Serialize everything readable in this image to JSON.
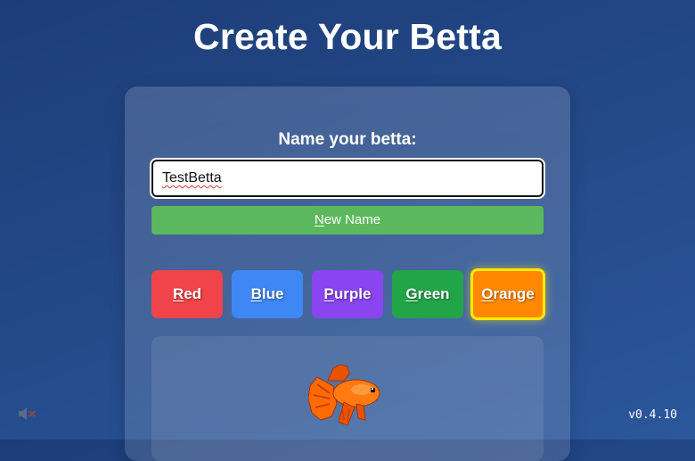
{
  "page": {
    "title": "Create Your Betta"
  },
  "name_form": {
    "label": "Name your betta:",
    "input_value": "TestBetta",
    "new_name_button": {
      "hotkey": "N",
      "rest": "ew Name"
    }
  },
  "colors": [
    {
      "id": "red",
      "hotkey": "R",
      "rest": "ed",
      "color": "#f0444a",
      "selected": false
    },
    {
      "id": "blue",
      "hotkey": "B",
      "rest": "lue",
      "color": "#3f87f5",
      "selected": false
    },
    {
      "id": "purple",
      "hotkey": "P",
      "rest": "urple",
      "color": "#8a44f0",
      "selected": false
    },
    {
      "id": "green",
      "hotkey": "G",
      "rest": "reen",
      "color": "#22a449",
      "selected": false
    },
    {
      "id": "orange",
      "hotkey": "O",
      "rest": "range",
      "color": "#ff8800",
      "selected": true
    }
  ],
  "preview": {
    "fish_icon": "betta-fish-icon",
    "fish_color": "#ff6a00"
  },
  "footer": {
    "mute_icon": "speaker-muted-icon",
    "version": "v0.4.10"
  }
}
